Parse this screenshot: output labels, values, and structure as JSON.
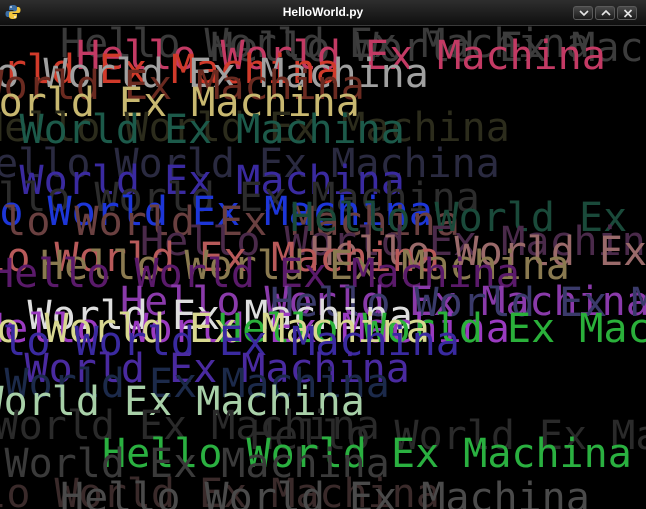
{
  "window": {
    "title": "HelloWorld.py",
    "icon": "python-icon",
    "controls": [
      "minimize-icon",
      "maximize-icon",
      "close-icon"
    ]
  },
  "canvas": {
    "background": "#000000",
    "texts": [
      {
        "text": "Hello World Ex Machina",
        "color": "#3a3a3a"
      },
      {
        "text": "Hello World Ex Machina",
        "color": "#3c3c3c"
      },
      {
        "text": "Hello World Ex Machina",
        "color": "#c33a64"
      },
      {
        "text": "Hello World Ex Machina",
        "color": "#d03a2a"
      },
      {
        "text": "Hello World Ex Machina",
        "color": "#a0a0a0"
      },
      {
        "text": "Hello World Ex Machina",
        "color": "#6a2a20"
      },
      {
        "text": "Hello World Ex Machina",
        "color": "#c8b870"
      },
      {
        "text": "Hello World Ex Machina",
        "color": "#2c2c1c"
      },
      {
        "text": "Hello World Ex Machina",
        "color": "#1c5a4a"
      },
      {
        "text": "Hello World Ex Machina",
        "color": "#2a2a40"
      },
      {
        "text": "Hello World Ex Machina",
        "color": "#3a2aa0"
      },
      {
        "text": "Hello World Ex Machina",
        "color": "#2c2c2c"
      },
      {
        "text": "Hello World Ex Machina",
        "color": "#1d36d8"
      },
      {
        "text": "Hello World Ex Machina",
        "color": "#6a4040"
      },
      {
        "text": "Hello World Ex Machina",
        "color": "#1a4a3a"
      },
      {
        "text": "Hello World Ex Machina",
        "color": "#4a2a4a"
      },
      {
        "text": "Hello World Ex Machina",
        "color": "#9a6a6a"
      },
      {
        "text": "Hello World Ex Machina",
        "color": "#b85a5a"
      },
      {
        "text": "Hello World Ex Machina",
        "color": "#8a7a50"
      },
      {
        "text": "Hello World Ex Machina",
        "color": "#5a1a6a"
      },
      {
        "text": "Hello World Ex Machina",
        "color": "#8a3aaa"
      },
      {
        "text": "Hello World Ex Machina",
        "color": "#3a3a6a"
      },
      {
        "text": "Hello World Ex Machina",
        "color": "#dedede"
      },
      {
        "text": "Hello World Ex Machina",
        "color": "#9a3ac0"
      },
      {
        "text": "Hello World Ex Machina",
        "color": "#2ab03a"
      },
      {
        "text": "Hello World Ex Machina",
        "color": "#d8d890"
      },
      {
        "text": "Hello World Ex Machina",
        "color": "#3a2aa0"
      },
      {
        "text": "Hello World Ex Machina",
        "color": "#4a2aa0"
      },
      {
        "text": "Hello World Ex Machina",
        "color": "#1c2a4a"
      },
      {
        "text": "Hello World Ex Machina",
        "color": "#a8d0a8"
      },
      {
        "text": "Hello World Ex Machina",
        "color": "#2a2a2a"
      },
      {
        "text": "Hello World Ex Machina",
        "color": "#2a2a2a"
      },
      {
        "text": "Hello World Ex Machina",
        "color": "#2ab040"
      },
      {
        "text": "Hello World Ex Machina",
        "color": "#3a3a3a"
      },
      {
        "text": "Hello World Ex Machina",
        "color": "#3a2a2a"
      },
      {
        "text": "Hello World Ex Machina",
        "color": "#4a4a4a"
      }
    ]
  }
}
